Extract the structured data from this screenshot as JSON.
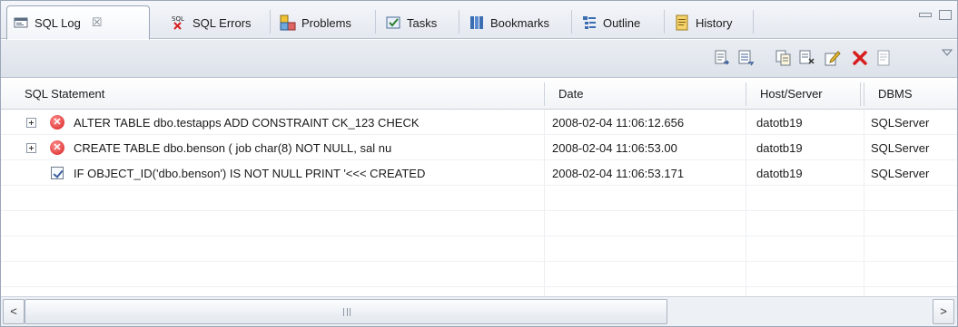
{
  "tabs": [
    {
      "label": "SQL Log",
      "icon": "sql-log-icon",
      "active": true
    },
    {
      "label": "SQL Errors",
      "icon": "sql-errors-icon"
    },
    {
      "label": "Problems",
      "icon": "problems-icon"
    },
    {
      "label": "Tasks",
      "icon": "tasks-icon"
    },
    {
      "label": "Bookmarks",
      "icon": "bookmarks-icon"
    },
    {
      "label": "Outline",
      "icon": "outline-icon"
    },
    {
      "label": "History",
      "icon": "history-icon"
    }
  ],
  "tab_close_glyph": "☒",
  "toolbar": {
    "icons": [
      "export-icon",
      "filter-icon",
      "copy-icon",
      "copy-all-icon",
      "edit-icon",
      "delete-icon",
      "document-icon",
      "view-menu-icon"
    ]
  },
  "table": {
    "columns": [
      "SQL Statement",
      "Date",
      "Host/Server",
      "DBMS"
    ],
    "rows": [
      {
        "status": "error",
        "expandable": true,
        "statement": "ALTER TABLE dbo.testapps    ADD CONSTRAINT CK_123    CHECK",
        "date": "2008-02-04 11:06:12.656",
        "host": "datotb19",
        "dbms": "SQLServer"
      },
      {
        "status": "error",
        "expandable": true,
        "statement": "CREATE TABLE dbo.benson (    job char(8)        NOT NULL,      sal nu",
        "date": "2008-02-04 11:06:53.00",
        "host": "datotb19",
        "dbms": "SQLServer"
      },
      {
        "status": "success",
        "expandable": false,
        "statement": "IF OBJECT_ID('dbo.benson') IS NOT NULL    PRINT '<<< CREATED",
        "date": "2008-02-04 11:06:53.171",
        "host": "datotb19",
        "dbms": "SQLServer"
      }
    ]
  },
  "scrollbar": {
    "left_glyph": "<",
    "right_glyph": ">"
  },
  "colors": {
    "error": "#d71f1f",
    "accent": "#3c5f9e"
  }
}
